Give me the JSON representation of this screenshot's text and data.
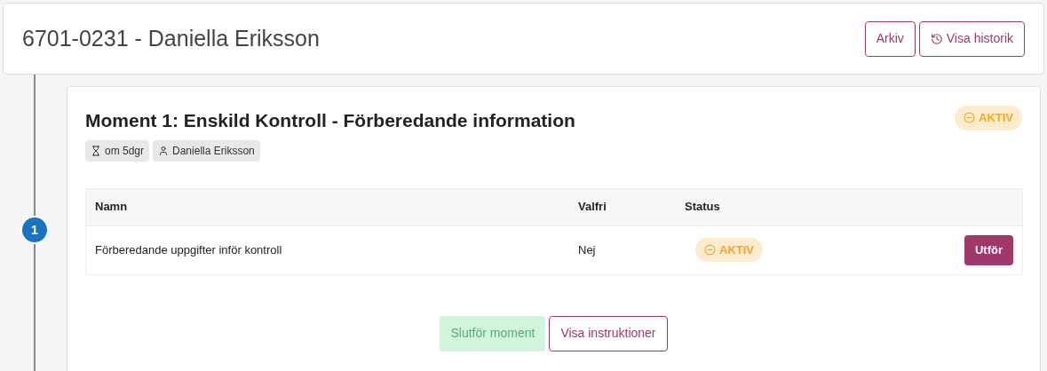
{
  "header": {
    "title": "6701-0231 - Daniella Eriksson",
    "buttons": [
      {
        "label": "Arkiv",
        "kind": "plain"
      },
      {
        "label": "Visa historik",
        "kind": "history"
      }
    ]
  },
  "step": {
    "number": "1",
    "title": "Moment 1: Enskild Kontroll - Förberedande information",
    "status": {
      "label": "AKTIV",
      "kind": "active"
    },
    "tags": [
      {
        "label": "om 5dgr",
        "kind": "deadline"
      },
      {
        "label": "Daniella Eriksson",
        "kind": "person"
      }
    ],
    "table": {
      "columns": [
        "Namn",
        "Valfri",
        "Status"
      ],
      "rows": [
        {
          "name": "Förberedande uppgifter inför kontroll",
          "optional": "Nej",
          "status": {
            "label": "AKTIV",
            "kind": "active"
          },
          "action": "Utför"
        }
      ]
    },
    "footer_buttons": [
      {
        "label": "Slutför moment",
        "kind": "primary",
        "disabled": true
      },
      {
        "label": "Visa instruktioner",
        "kind": "outline",
        "disabled": false
      }
    ]
  }
}
